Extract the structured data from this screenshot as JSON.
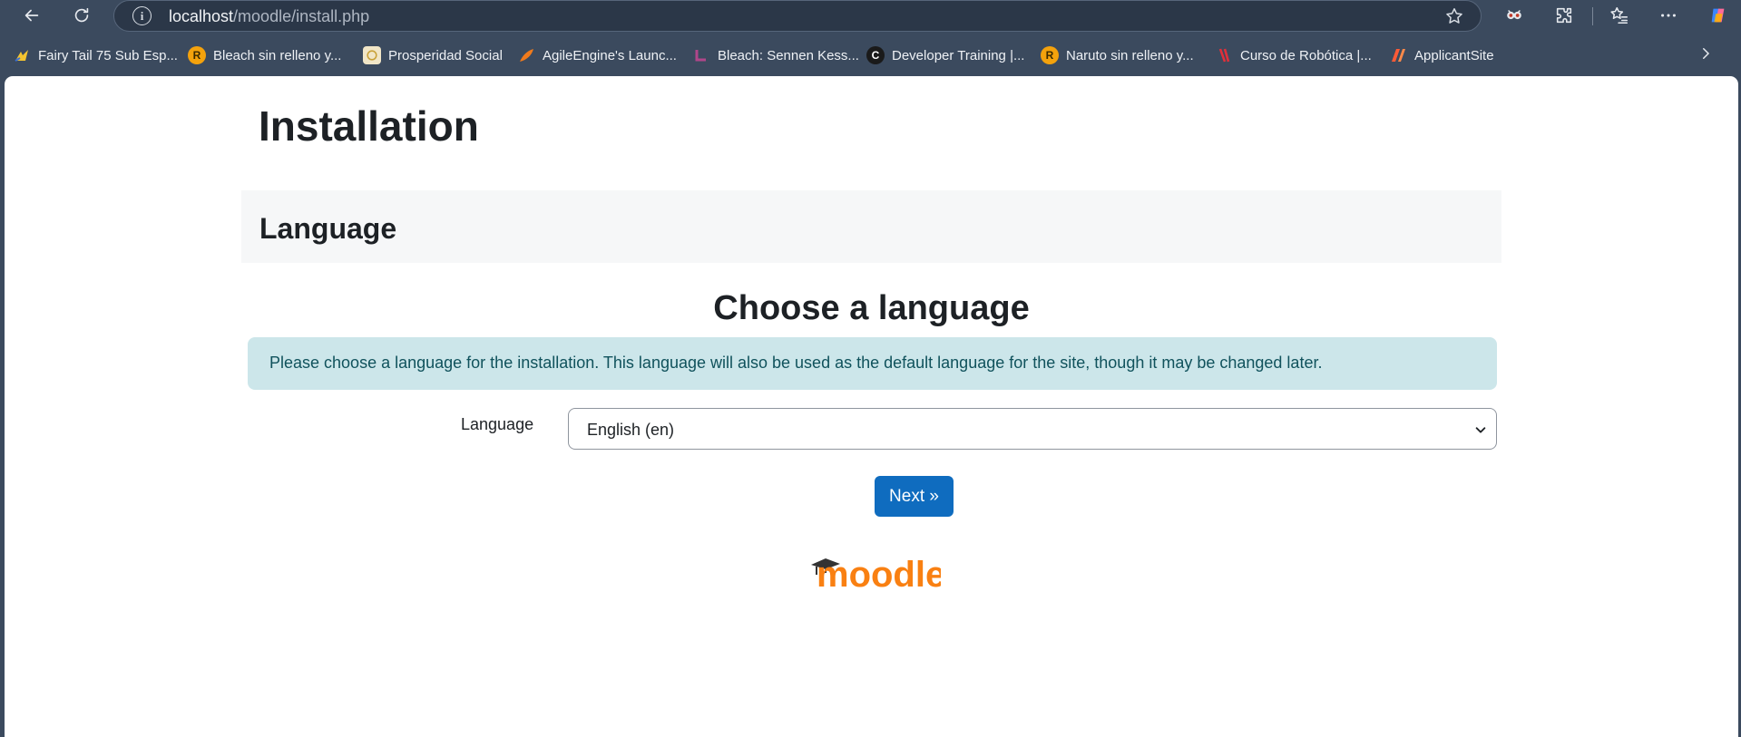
{
  "browser": {
    "url_host": "localhost",
    "url_path": "/moodle/install.php",
    "bookmarks": [
      {
        "label": "Fairy Tail 75 Sub Esp...",
        "icon": "fairy-tail-icon",
        "color": "#f4c430"
      },
      {
        "label": "Bleach sin relleno y...",
        "icon": "r-circle-icon",
        "badge": "R",
        "color": "#f4a20c"
      },
      {
        "label": "Prosperidad Social",
        "icon": "prosperidad-icon",
        "color": "#f1e6c7"
      },
      {
        "label": "AgileEngine's Launc...",
        "icon": "agileengine-icon",
        "color": "#f07a1c"
      },
      {
        "label": "Bleach: Sennen Kess...",
        "icon": "bleach-icon",
        "color": "#b0468a"
      },
      {
        "label": "Developer Training |...",
        "icon": "c-icon",
        "badge": "C",
        "color": "#1a1a1a"
      },
      {
        "label": "Naruto sin relleno y...",
        "icon": "r-circle-icon",
        "badge": "R",
        "color": "#f4a20c"
      },
      {
        "label": "Curso de Robótica |...",
        "icon": "robotica-icon",
        "color": "#e0303a"
      },
      {
        "label": "ApplicantSite",
        "icon": "applicantsite-icon",
        "color": "#ff5a36"
      }
    ]
  },
  "page": {
    "title": "Installation",
    "section": "Language",
    "heading": "Choose a language",
    "info": "Please choose a language for the installation. This language will also be used as the default language for the site, though it may be changed later.",
    "language_label": "Language",
    "language_value": "English (en)",
    "next_label": "Next »",
    "logo_text": "moodle"
  },
  "colors": {
    "brand_blue": "#0f6cbf",
    "moodle_orange": "#f98012",
    "info_bg": "#cce6ea",
    "info_text": "#10525c"
  }
}
